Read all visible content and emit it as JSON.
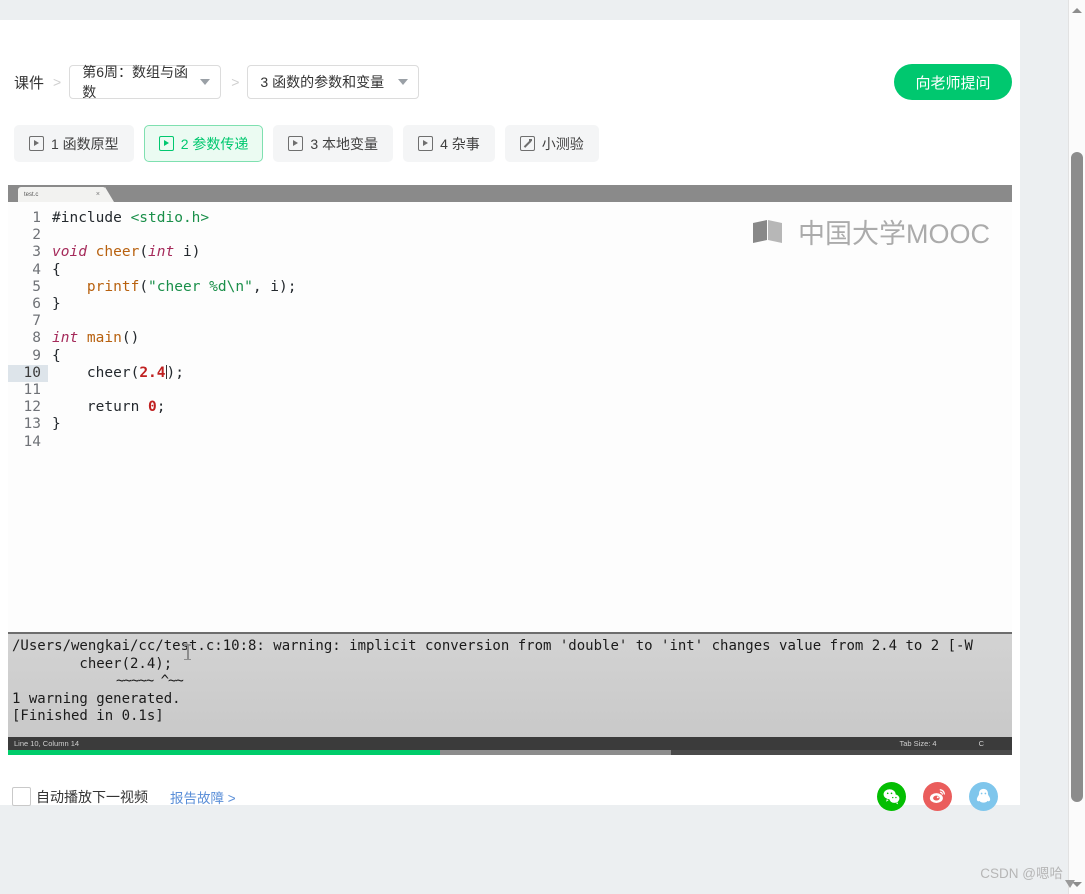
{
  "breadcrumb": {
    "root": "课件",
    "separator": ">",
    "week_select": "第6周：数组与函数",
    "lesson_select": "3 函数的参数和变量"
  },
  "header": {
    "ask_button": "向老师提问"
  },
  "tabs": [
    {
      "label": "1 函数原型",
      "icon": "play-icon",
      "active": false
    },
    {
      "label": "2 参数传递",
      "icon": "play-icon",
      "active": true
    },
    {
      "label": "3 本地变量",
      "icon": "play-icon",
      "active": false
    },
    {
      "label": "4 杂事",
      "icon": "play-icon",
      "active": false
    },
    {
      "label": "小测验",
      "icon": "pencil-icon",
      "active": false
    }
  ],
  "editor": {
    "file_tab": "test.c",
    "close_label": "×",
    "line_numbers": [
      "1",
      "2",
      "3",
      "4",
      "5",
      "6",
      "7",
      "8",
      "9",
      "10",
      "11",
      "12",
      "13",
      "14"
    ],
    "current_line": 10,
    "watermark": "中国大学MOOC",
    "code": {
      "l1_include": "#include ",
      "l1_header": "<stdio.h>",
      "l3_type": "void",
      "l3_fn": " cheer",
      "l3_open": "(",
      "l3_param_type": "int",
      "l3_param": " i)",
      "l4": "{",
      "l5_fn": "    printf",
      "l5_open": "(",
      "l5_str": "\"cheer %d\\n\"",
      "l5_rest": ", i);",
      "l6": "}",
      "l8_type": "int",
      "l8_fn": " main",
      "l8_rest": "()",
      "l9": "{",
      "l10_fn": "    cheer",
      "l10_open": "(",
      "l10_num": "2.4",
      "l10_close": ");",
      "l12_kw": "    return ",
      "l12_num": "0",
      "l12_end": ";",
      "l13": "}"
    }
  },
  "console": {
    "line1": "/Users/wengkai/cc/test.c:10:8: warning: implicit conversion from 'double' to 'int' changes value from 2.4 to 2 [-W",
    "line2": "        cheer(2.4);",
    "line3": "              ~~~~~ ^~~",
    "line4": "1 warning generated.",
    "line5": "[Finished in 0.1s]"
  },
  "statusbar": {
    "position": "Line 10, Column 14",
    "tab_size": "Tab Size: 4",
    "language": "C",
    "played_percent": 43,
    "buffered_percent": 66
  },
  "bottombar": {
    "autoplay_label": "自动播放下一视频",
    "autoplay_checked": false,
    "report_link": "报告故障 >",
    "socials": [
      {
        "name": "wechat-share-icon",
        "color": "#04be02"
      },
      {
        "name": "weibo-share-icon",
        "color": "#ea5d5c"
      },
      {
        "name": "qq-share-icon",
        "color": "#7fc6ec"
      }
    ]
  },
  "watermark": {
    "csdn": "CSDN @嗯哈"
  },
  "colors": {
    "accent_green": "#00c86f",
    "link_blue": "#5b8fd8",
    "page_bg": "#eceff1"
  }
}
